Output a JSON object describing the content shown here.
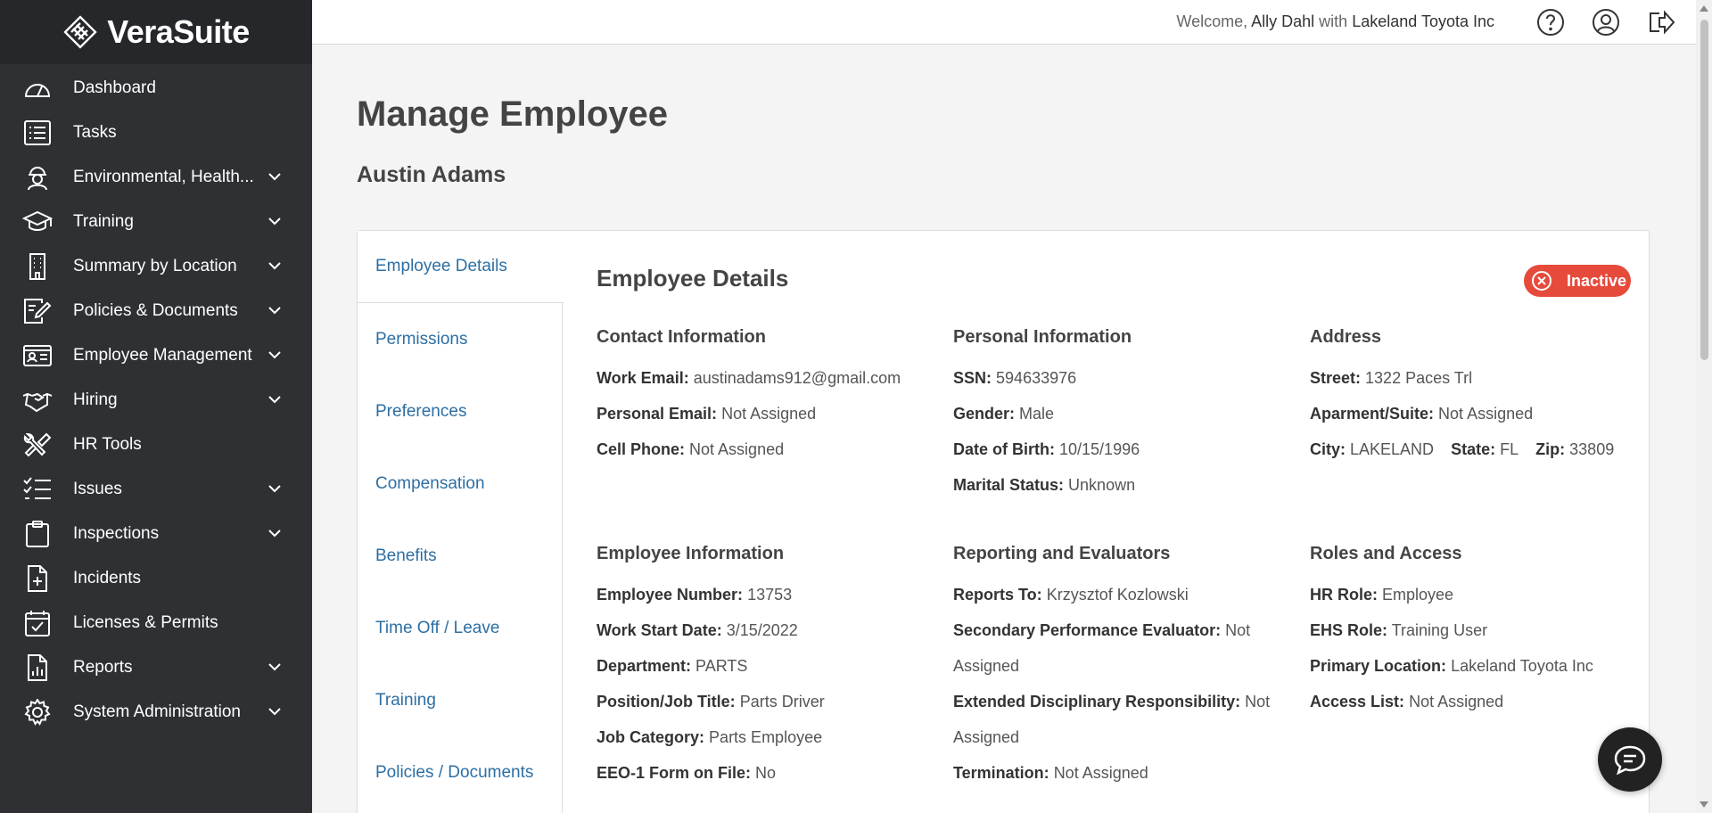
{
  "brand": {
    "name": "VeraSuite",
    "logo": "verasuite-diamond-logo"
  },
  "topbar": {
    "welcome_prefix": "Welcome,",
    "user_name": "Ally Dahl",
    "with_text": "with",
    "company": "Lakeland Toyota Inc",
    "icons": [
      "help-icon",
      "user-icon",
      "logout-icon"
    ]
  },
  "sidebar": {
    "items": [
      {
        "label": "Dashboard",
        "icon": "dashboard-icon",
        "expandable": false
      },
      {
        "label": "Tasks",
        "icon": "tasks-icon",
        "expandable": false
      },
      {
        "label": "Environmental, Health...",
        "icon": "hardhat-icon",
        "expandable": true
      },
      {
        "label": "Training",
        "icon": "graduation-cap-icon",
        "expandable": true
      },
      {
        "label": "Summary by Location",
        "icon": "building-icon",
        "expandable": true
      },
      {
        "label": "Policies & Documents",
        "icon": "document-pen-icon",
        "expandable": true
      },
      {
        "label": "Employee Management",
        "icon": "id-card-icon",
        "expandable": true
      },
      {
        "label": "Hiring",
        "icon": "handshake-icon",
        "expandable": true
      },
      {
        "label": "HR Tools",
        "icon": "tools-icon",
        "expandable": false
      },
      {
        "label": "Issues",
        "icon": "checklist-icon",
        "expandable": true
      },
      {
        "label": "Inspections",
        "icon": "clipboard-icon",
        "expandable": true
      },
      {
        "label": "Incidents",
        "icon": "file-plus-icon",
        "expandable": false
      },
      {
        "label": "Licenses & Permits",
        "icon": "calendar-check-icon",
        "expandable": false
      },
      {
        "label": "Reports",
        "icon": "report-chart-icon",
        "expandable": true
      },
      {
        "label": "System Administration",
        "icon": "gear-icon",
        "expandable": true
      }
    ]
  },
  "main": {
    "title": "Manage Employee",
    "employee_name": "Austin Adams",
    "tabs": [
      {
        "label": "Employee Details",
        "active": true
      },
      {
        "label": "Permissions"
      },
      {
        "label": "Preferences"
      },
      {
        "label": "Compensation"
      },
      {
        "label": "Benefits"
      },
      {
        "label": "Time Off / Leave"
      },
      {
        "label": "Training"
      },
      {
        "label": "Policies / Documents"
      }
    ],
    "details": {
      "title": "Employee Details",
      "status": "Inactive",
      "status_color": "#e64a3b",
      "contact": {
        "heading": "Contact Information",
        "work_email_label": "Work Email:",
        "work_email": "austinadams912@gmail.com",
        "personal_email_label": "Personal Email:",
        "personal_email": "Not Assigned",
        "cell_label": "Cell Phone:",
        "cell": "Not Assigned"
      },
      "personal": {
        "heading": "Personal Information",
        "ssn_label": "SSN:",
        "ssn": "594633976",
        "gender_label": "Gender:",
        "gender": "Male",
        "dob_label": "Date of Birth:",
        "dob": "10/15/1996",
        "marital_label": "Marital Status:",
        "marital": "Unknown"
      },
      "address": {
        "heading": "Address",
        "street_label": "Street:",
        "street": "1322 Paces Trl",
        "suite_label": "Aparment/Suite:",
        "suite": "Not Assigned",
        "city_label": "City:",
        "city": "LAKELAND",
        "state_label": "State:",
        "state": "FL",
        "zip_label": "Zip:",
        "zip": "33809"
      },
      "employee": {
        "heading": "Employee Information",
        "number_label": "Employee Number:",
        "number": "13753",
        "start_label": "Work Start Date:",
        "start": "3/15/2022",
        "dept_label": "Department:",
        "dept": "PARTS",
        "position_label": "Position/Job Title:",
        "position": "Parts Driver",
        "category_label": "Job Category:",
        "category": "Parts Employee",
        "eeo_label": "EEO-1 Form on File:",
        "eeo": "No"
      },
      "reporting": {
        "heading": "Reporting and Evaluators",
        "reports_label": "Reports To:",
        "reports": "Krzysztof Kozlowski",
        "secondary_label": "Secondary Performance Evaluator:",
        "secondary": "Not Assigned",
        "extended_label": "Extended Disciplinary Responsibility:",
        "extended": "Not Assigned",
        "termination_label": "Termination:",
        "termination": "Not Assigned"
      },
      "roles": {
        "heading": "Roles and Access",
        "hr_label": "HR Role:",
        "hr": "Employee",
        "ehs_label": "EHS Role:",
        "ehs": "Training User",
        "location_label": "Primary Location:",
        "location": "Lakeland Toyota Inc",
        "access_label": "Access List:",
        "access": "Not Assigned"
      }
    }
  },
  "chat": {
    "icon": "chat-bubble-icon"
  }
}
